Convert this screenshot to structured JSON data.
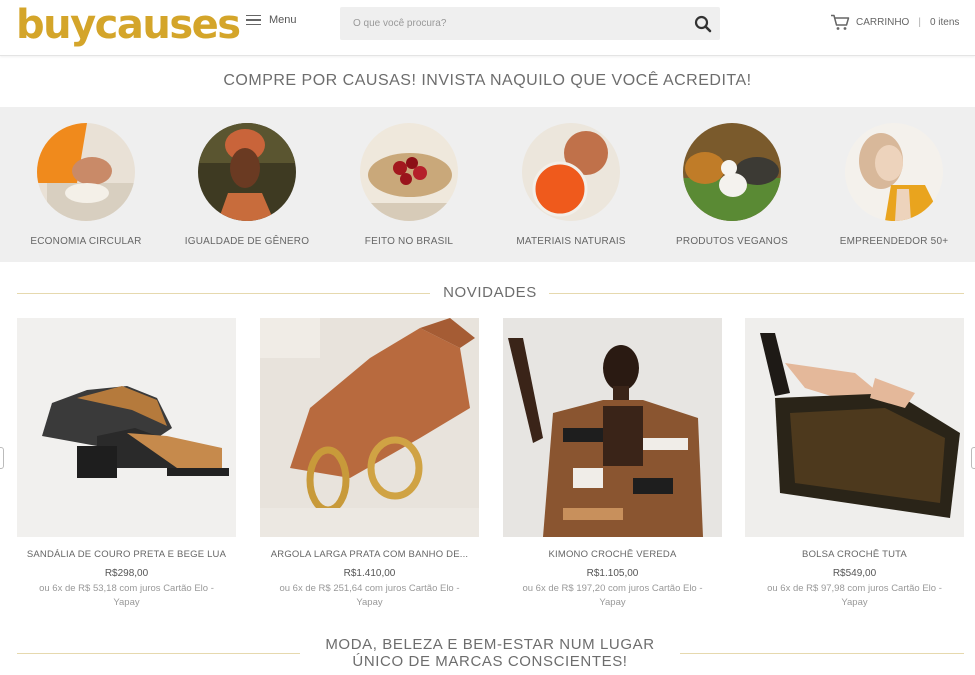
{
  "header": {
    "logo": "buycauses",
    "menu_label": "Menu",
    "search_placeholder": "O que você procura?",
    "cart_label": "CARRINHO",
    "cart_separator": "|",
    "cart_count": "0 itens"
  },
  "tagline": "COMPRE POR CAUSAS! INVISTA NAQUILO QUE VOCÊ ACREDITA!",
  "categories": [
    {
      "label": "ECONOMIA CIRCULAR"
    },
    {
      "label": "IGUALDADE DE GÊNERO"
    },
    {
      "label": "FEITO NO BRASIL"
    },
    {
      "label": "MATERIAIS NATURAIS"
    },
    {
      "label": "PRODUTOS VEGANOS"
    },
    {
      "label": "EMPREENDEDOR 50+"
    }
  ],
  "novidades_title": "NOVIDADES",
  "products": [
    {
      "name": "SANDÁLIA DE COURO PRETA E BEGE LUA",
      "price": "R$298,00",
      "installments": "ou 6x de R$ 53,18 com juros Cartão Elo - Yapay"
    },
    {
      "name": "ARGOLA LARGA PRATA COM BANHO DE...",
      "price": "R$1.410,00",
      "installments": "ou 6x de R$ 251,64 com juros Cartão Elo - Yapay"
    },
    {
      "name": "KIMONO CROCHÊ VEREDA",
      "price": "R$1.105,00",
      "installments": "ou 6x de R$ 197,20 com juros Cartão Elo - Yapay"
    },
    {
      "name": "BOLSA CROCHÊ TUTA",
      "price": "R$549,00",
      "installments": "ou 6x de R$ 97,98 com juros Cartão Elo - Yapay"
    }
  ],
  "bottom_title": "MODA, BELEZA E BEM-ESTAR NUM LUGAR ÚNICO DE MARCAS CONSCIENTES!",
  "colors": {
    "brand": "#d4a52a",
    "line": "#e6d9ae",
    "category_bg": "#efefef"
  }
}
